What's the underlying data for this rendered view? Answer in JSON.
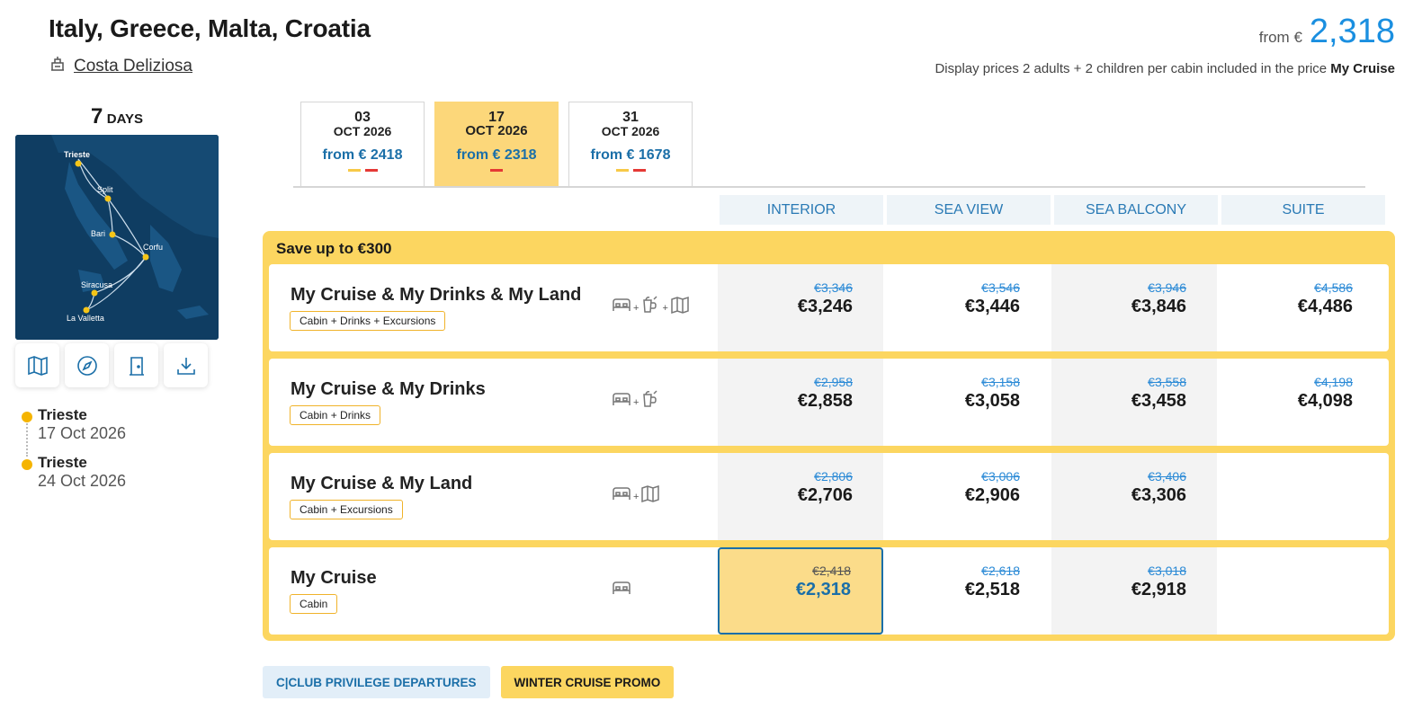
{
  "header": {
    "title": "Italy, Greece, Malta, Croatia",
    "ship_name": "Costa Deliziosa",
    "from_label": "from €",
    "from_value": "2,318",
    "display_prices_text": "Display prices 2 adults + 2 children per cabin included in the price",
    "display_prices_bold": "My Cruise"
  },
  "sidebar": {
    "days_num": "7",
    "days_unit": "DAYS",
    "map_ports": [
      "Trieste",
      "Split",
      "Bari",
      "Corfu",
      "Siracusa",
      "La Valletta"
    ],
    "itinerary": [
      {
        "port": "Trieste",
        "date": "17 Oct 2026"
      },
      {
        "port": "Trieste",
        "date": "24 Oct 2026"
      }
    ]
  },
  "date_tabs": [
    {
      "day": "03",
      "month": "OCT 2026",
      "price": "from € 2418",
      "active": false
    },
    {
      "day": "17",
      "month": "OCT 2026",
      "price": "from € 2318",
      "active": true
    },
    {
      "day": "31",
      "month": "OCT 2026",
      "price": "from € 1678",
      "active": false
    }
  ],
  "columns": [
    "INTERIOR",
    "SEA VIEW",
    "SEA BALCONY",
    "SUITE"
  ],
  "promo": {
    "title": "Save up to €300",
    "rows": [
      {
        "name": "My Cruise & My Drinks & My Land",
        "tag": "Cabin + Drinks + Excursions",
        "icons": [
          "bed-icon",
          "drink-icon",
          "map-icon"
        ],
        "prices": [
          {
            "old": "€3,346",
            "new": "€3,246"
          },
          {
            "old": "€3,546",
            "new": "€3,446"
          },
          {
            "old": "€3,946",
            "new": "€3,846"
          },
          {
            "old": "€4,586",
            "new": "€4,486"
          }
        ]
      },
      {
        "name": "My Cruise & My Drinks",
        "tag": "Cabin + Drinks",
        "icons": [
          "bed-icon",
          "drink-icon"
        ],
        "prices": [
          {
            "old": "€2,958",
            "new": "€2,858"
          },
          {
            "old": "€3,158",
            "new": "€3,058"
          },
          {
            "old": "€3,558",
            "new": "€3,458"
          },
          {
            "old": "€4,198",
            "new": "€4,098"
          }
        ]
      },
      {
        "name": "My Cruise & My Land",
        "tag": "Cabin + Excursions",
        "icons": [
          "bed-icon",
          "map-icon"
        ],
        "prices": [
          {
            "old": "€2,806",
            "new": "€2,706"
          },
          {
            "old": "€3,006",
            "new": "€2,906"
          },
          {
            "old": "€3,406",
            "new": "€3,306"
          }
        ]
      },
      {
        "name": "My Cruise",
        "tag": "Cabin",
        "icons": [
          "bed-icon"
        ],
        "prices": [
          {
            "old": "€2,418",
            "new": "€2,318"
          },
          {
            "old": "€2,618",
            "new": "€2,518"
          },
          {
            "old": "€3,018",
            "new": "€2,918"
          }
        ]
      }
    ]
  },
  "badges": {
    "club": "C|CLUB PRIVILEGE DEPARTURES",
    "winter": "WINTER CRUISE PROMO"
  },
  "colors": {
    "accent_blue": "#1a8fe0",
    "dark_blue": "#1b6fa8",
    "promo_yellow": "#fcd660",
    "map_sea": "#0f3d62"
  }
}
